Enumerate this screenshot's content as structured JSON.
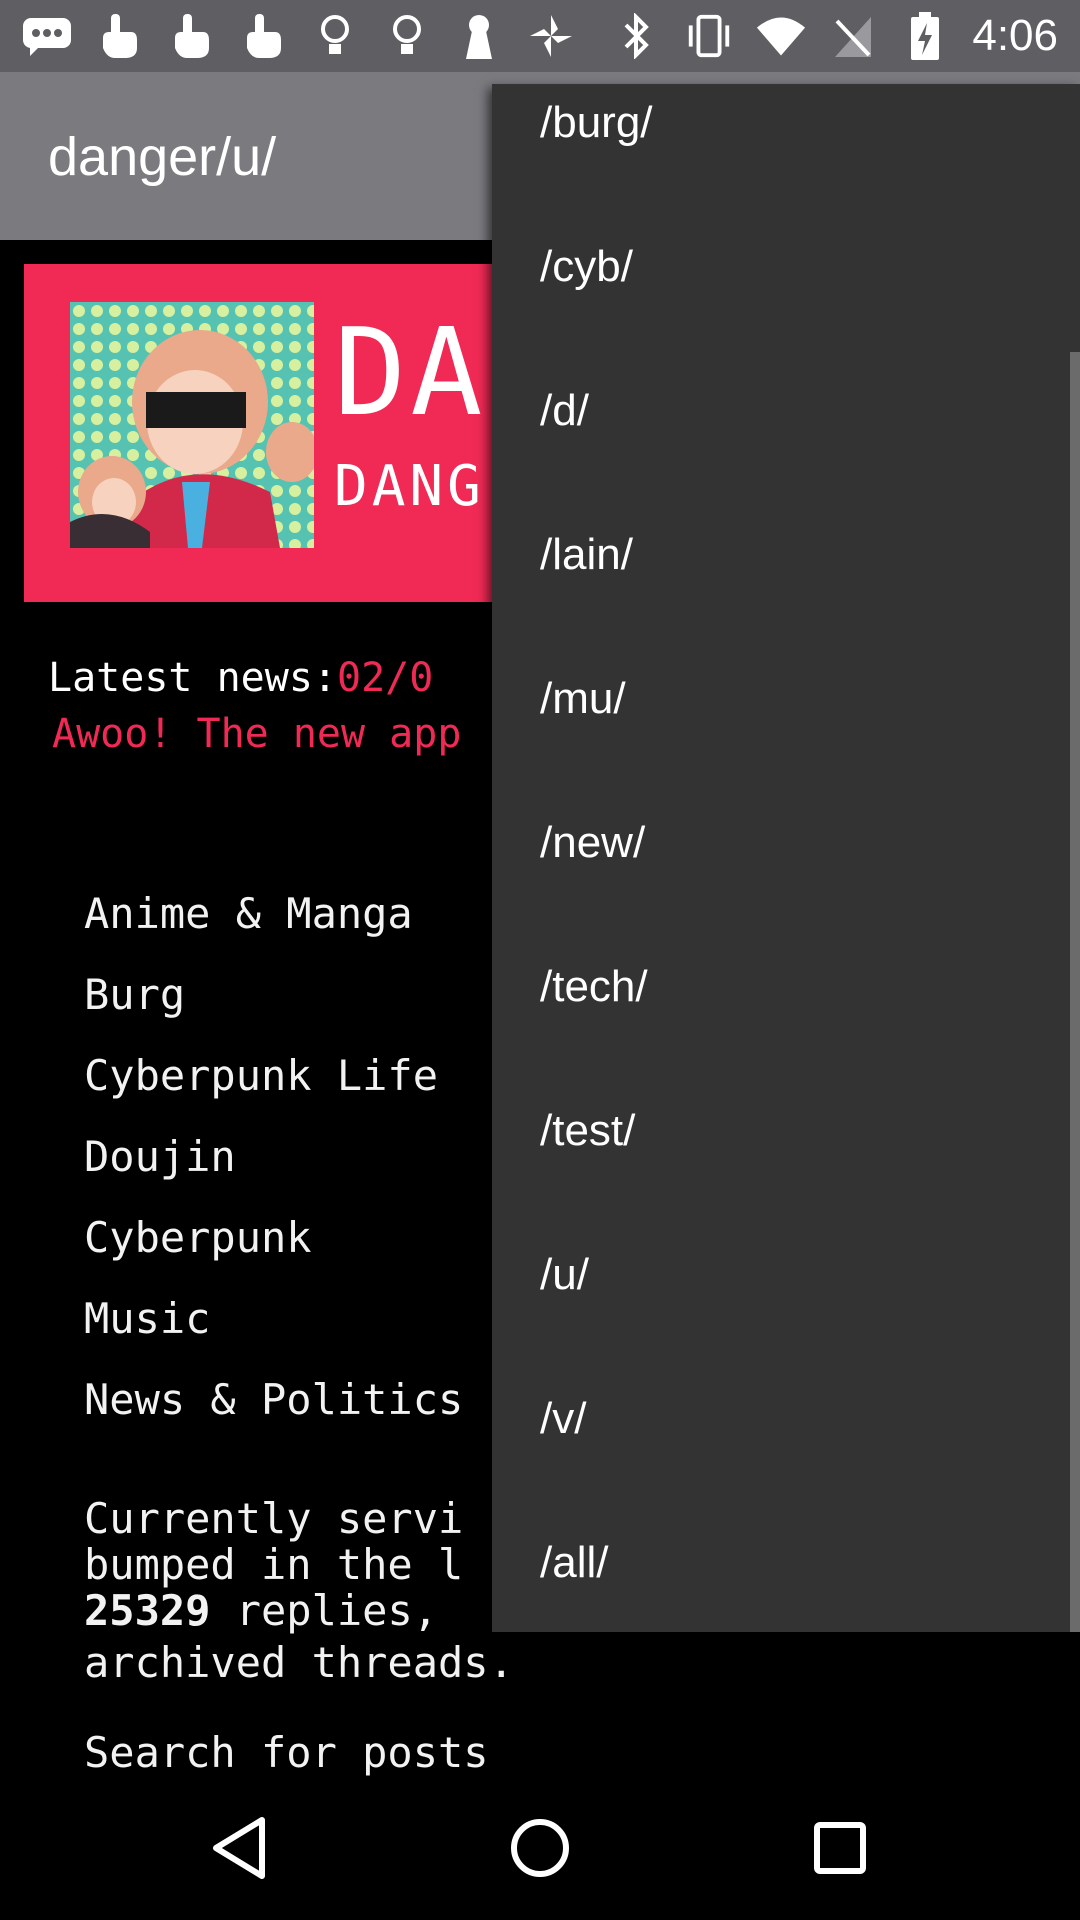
{
  "status_bar": {
    "time": "4:06",
    "left_icons": [
      "message-icon",
      "touch-icon",
      "touch-icon",
      "touch-icon",
      "bulb-icon",
      "bulb-icon",
      "keyhole-icon",
      "pinwheel-icon"
    ],
    "right_icons": [
      "bluetooth-icon",
      "vibrate-icon",
      "wifi-icon",
      "no-sim-icon",
      "battery-charging-icon"
    ]
  },
  "app_bar": {
    "title": "danger/u/"
  },
  "banner": {
    "title": "DA",
    "subtitle": "DANG"
  },
  "news": {
    "label": "Latest news:",
    "date": "02/0",
    "body": "Awoo! The new app"
  },
  "boards": [
    "Anime & Manga",
    "Burg",
    "Cyberpunk Life",
    "Doujin",
    "Cyberpunk",
    "Music",
    "News & Politics"
  ],
  "stats": {
    "line1": "Currently servi",
    "line2": "bumped in the l",
    "replies_count": "25329",
    "line3_rest": " replies,",
    "line4": "archived threads."
  },
  "search_link": "Search for posts",
  "dropdown": {
    "items": [
      "/burg/",
      "/cyb/",
      "/d/",
      "/lain/",
      "/mu/",
      "/new/",
      "/tech/",
      "/test/",
      "/u/",
      "/v/",
      "/all/"
    ]
  },
  "nav_bar": {
    "buttons": [
      "back-icon",
      "home-icon",
      "recents-icon"
    ]
  },
  "colors": {
    "accent": "#f02a55",
    "statusbar": "#5f5e63",
    "appbar": "#7b7a7f",
    "dropdown": "#333333"
  }
}
